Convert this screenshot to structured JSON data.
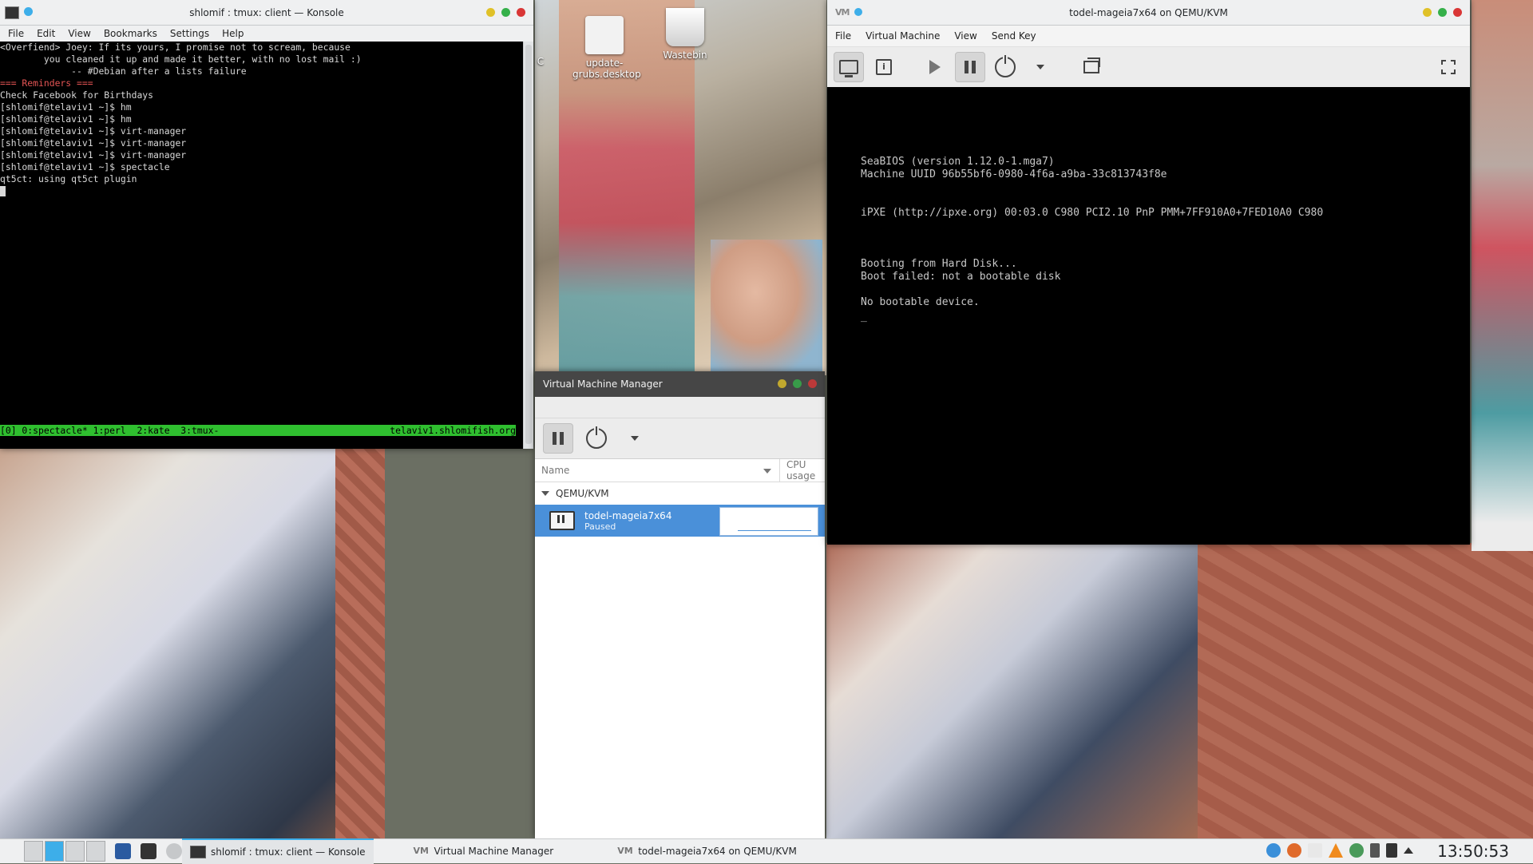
{
  "desktop": {
    "icons": [
      {
        "label": "update-grubs.desktop"
      },
      {
        "label": "Wastebin"
      }
    ],
    "partial_icon_label": "C"
  },
  "konsole": {
    "title": "shlomif : tmux: client — Konsole",
    "menu": [
      "File",
      "Edit",
      "View",
      "Bookmarks",
      "Settings",
      "Help"
    ],
    "lines": [
      "<Overfiend> Joey: If its yours, I promise not to scream, because",
      "        you cleaned it up and made it better, with no lost mail :)",
      "             -- #Debian after a lists failure",
      "=== Reminders ===",
      "Check Facebook for Birthdays",
      "[shlomif@telaviv1 ~]$ hm",
      "[shlomif@telaviv1 ~]$ hm",
      "[shlomif@telaviv1 ~]$ virt-manager",
      "[shlomif@telaviv1 ~]$ virt-manager",
      "[shlomif@telaviv1 ~]$ virt-manager",
      "[shlomif@telaviv1 ~]$ spectacle",
      "qt5ct: using qt5ct plugin"
    ],
    "tmux_left": "[0] 0:spectacle* 1:perl  2:kate  3:tmux-",
    "tmux_right": "telaviv1.shlomifish.org",
    "status_color": "#2fbf2f"
  },
  "vmm": {
    "title": "Virtual Machine Manager",
    "columns": {
      "name": "Name",
      "cpu": "CPU usage"
    },
    "group": "QEMU/KVM",
    "vm": {
      "name": "todel-mageia7x64",
      "state": "Paused"
    },
    "selection_color": "#4a90d9"
  },
  "viewer": {
    "title": "todel-mageia7x64 on QEMU/KVM",
    "menu": [
      "File",
      "Virtual Machine",
      "View",
      "Send Key"
    ],
    "logo": "VM",
    "bios": [
      "SeaBIOS (version 1.12.0-1.mga7)",
      "Machine UUID 96b55bf6-0980-4f6a-a9ba-33c813743f8e",
      "iPXE (http://ipxe.org) 00:03.0 C980 PCI2.10 PnP PMM+7FF910A0+7FED10A0 C980",
      "Booting from Hard Disk...",
      "Boot failed: not a bootable disk",
      "No bootable device.",
      "_"
    ]
  },
  "taskbar": {
    "tasks": [
      {
        "label": "shlomif : tmux: client — Konsole"
      },
      {
        "label": "Virtual Machine Manager"
      },
      {
        "label": "todel-mageia7x64 on QEMU/KVM"
      }
    ],
    "clock": "13:50:53",
    "accent": "#3daee9"
  }
}
